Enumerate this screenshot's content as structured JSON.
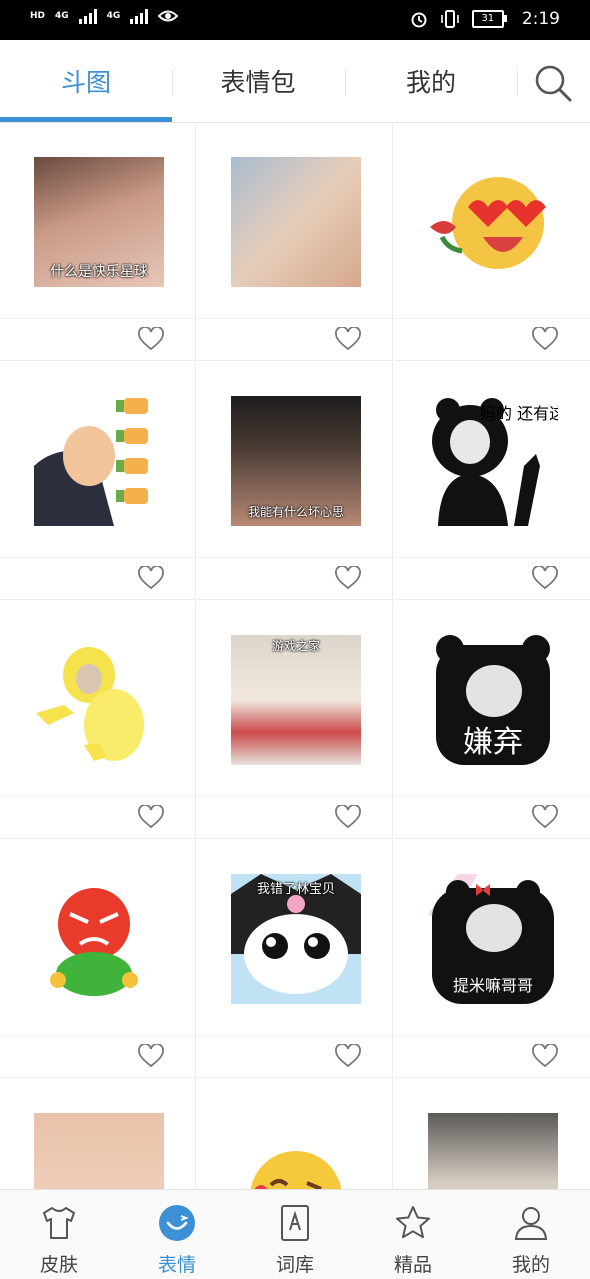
{
  "status_bar": {
    "left_tags": [
      "HD",
      "4G",
      "4G"
    ],
    "battery": "31",
    "time": "2:19"
  },
  "tabs": [
    {
      "label": "斗图",
      "active": true
    },
    {
      "label": "表情包",
      "active": false
    },
    {
      "label": "我的",
      "active": false
    }
  ],
  "search_icon": "search-icon",
  "stickers": [
    {
      "caption": "什么是快乐星球"
    },
    {
      "caption": ""
    },
    {
      "caption": ""
    },
    {
      "caption": ""
    },
    {
      "caption": "我能有什么坏心思"
    },
    {
      "caption": "妈的 还有这事 揍他狗日的"
    },
    {
      "caption": ""
    },
    {
      "caption": "游戏之家"
    },
    {
      "caption": "嫌弃"
    },
    {
      "caption": ""
    },
    {
      "caption": "我错了林宝贝"
    },
    {
      "caption": "提米嘛哥哥"
    },
    {
      "caption": ""
    },
    {
      "caption": ""
    },
    {
      "caption": ""
    }
  ],
  "bottom_nav": [
    {
      "label": "皮肤",
      "icon": "shirt-icon",
      "active": false
    },
    {
      "label": "表情",
      "icon": "emoji-icon",
      "active": true
    },
    {
      "label": "词库",
      "icon": "book-icon",
      "active": false
    },
    {
      "label": "精品",
      "icon": "star-icon",
      "active": false
    },
    {
      "label": "我的",
      "icon": "person-icon",
      "active": false
    }
  ],
  "colors": {
    "accent": "#3d8fd6",
    "text": "#333333",
    "divider": "#ececec"
  }
}
